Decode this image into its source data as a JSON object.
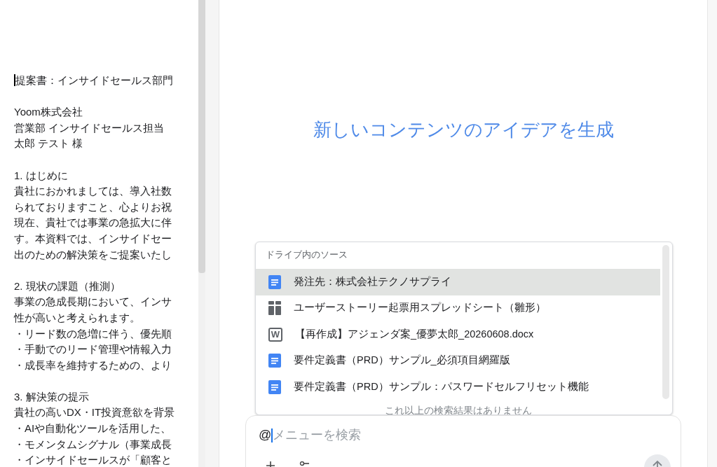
{
  "document": {
    "blocks": [
      {
        "lines": [
          "提案書：インサイドセールス部門"
        ]
      },
      {
        "lines": [
          "Yoom株式会社",
          "営業部 インサイドセールス担当",
          "太郎 テスト 様"
        ]
      },
      {
        "lines": [
          "1. はじめに",
          "貴社におかれましては、導入社数",
          "られておりますこと、心よりお祝",
          "現在、貴社では事業の急拡大に伴",
          "す。本資料では、インサイドセー",
          "出のための解決策をご提案いたし"
        ]
      },
      {
        "lines": [
          "2. 現状の課題（推測）",
          "事業の急成長期において、インサ",
          "性が高いと考えられます。",
          "・リード数の急増に伴う、優先順",
          "・手動でのリード管理や情報入力",
          "・成長率を維持するための、より"
        ]
      },
      {
        "lines": [
          "3. 解決策の提示",
          "貴社の高いDX・IT投資意欲を背景",
          "・AIや自動化ツールを活用した、",
          "・モメンタムシグナル（事業成長",
          "・インサイドセールスが「顧客と"
        ]
      }
    ]
  },
  "panel": {
    "title": "新しいコンテンツのアイデアを生成"
  },
  "dropdown": {
    "header": "ドライブ内のソース",
    "items": [
      {
        "kind": "doc",
        "label": "発注先：株式会社テクノサプライ",
        "selected": true
      },
      {
        "kind": "sheet",
        "label": "ユーザーストーリー起票用スプレッドシート（雛形）",
        "selected": false
      },
      {
        "kind": "word",
        "icon_text": "W",
        "label": "【再作成】アジェンダ案_優夢太郎_20260608.docx",
        "selected": false
      },
      {
        "kind": "doc",
        "label": "要件定義書（PRD）サンプル_必須項目網羅版",
        "selected": false
      },
      {
        "kind": "doc",
        "label": "要件定義書（PRD）サンプル：パスワードセルフリセット機能",
        "selected": false
      }
    ],
    "footer": "これ以上の検索結果はありません"
  },
  "input": {
    "value": "@",
    "placeholder": "メニューを検索"
  }
}
